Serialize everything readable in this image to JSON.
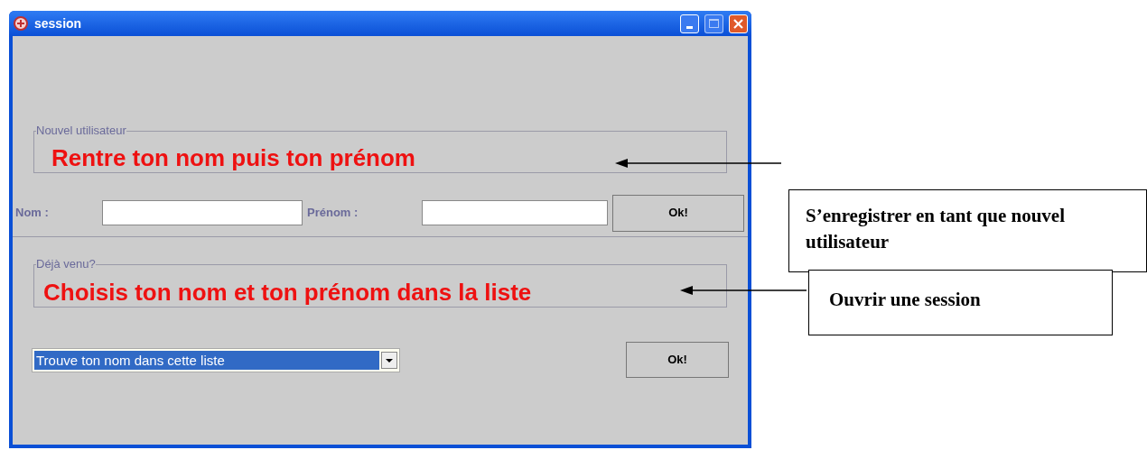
{
  "window": {
    "title": "session"
  },
  "groups": [
    {
      "legend": "Nouvel utilisateur",
      "instruction": "Rentre ton nom puis ton prénom"
    },
    {
      "legend": "Déjà venu?",
      "instruction": "Choisis ton nom et ton prénom dans la liste"
    }
  ],
  "new_user_form": {
    "fields": [
      {
        "label": "Nom :"
      },
      {
        "label": "Prénom :"
      }
    ],
    "button": "Ok!"
  },
  "session_form": {
    "dropdown": {
      "value": "Trouve ton nom dans cette liste"
    },
    "button": "Ok!"
  },
  "annotations": [
    {
      "text": "S’enregistrer en tant que nouvel utilisateur"
    },
    {
      "text": "Ouvrir une session"
    }
  ]
}
